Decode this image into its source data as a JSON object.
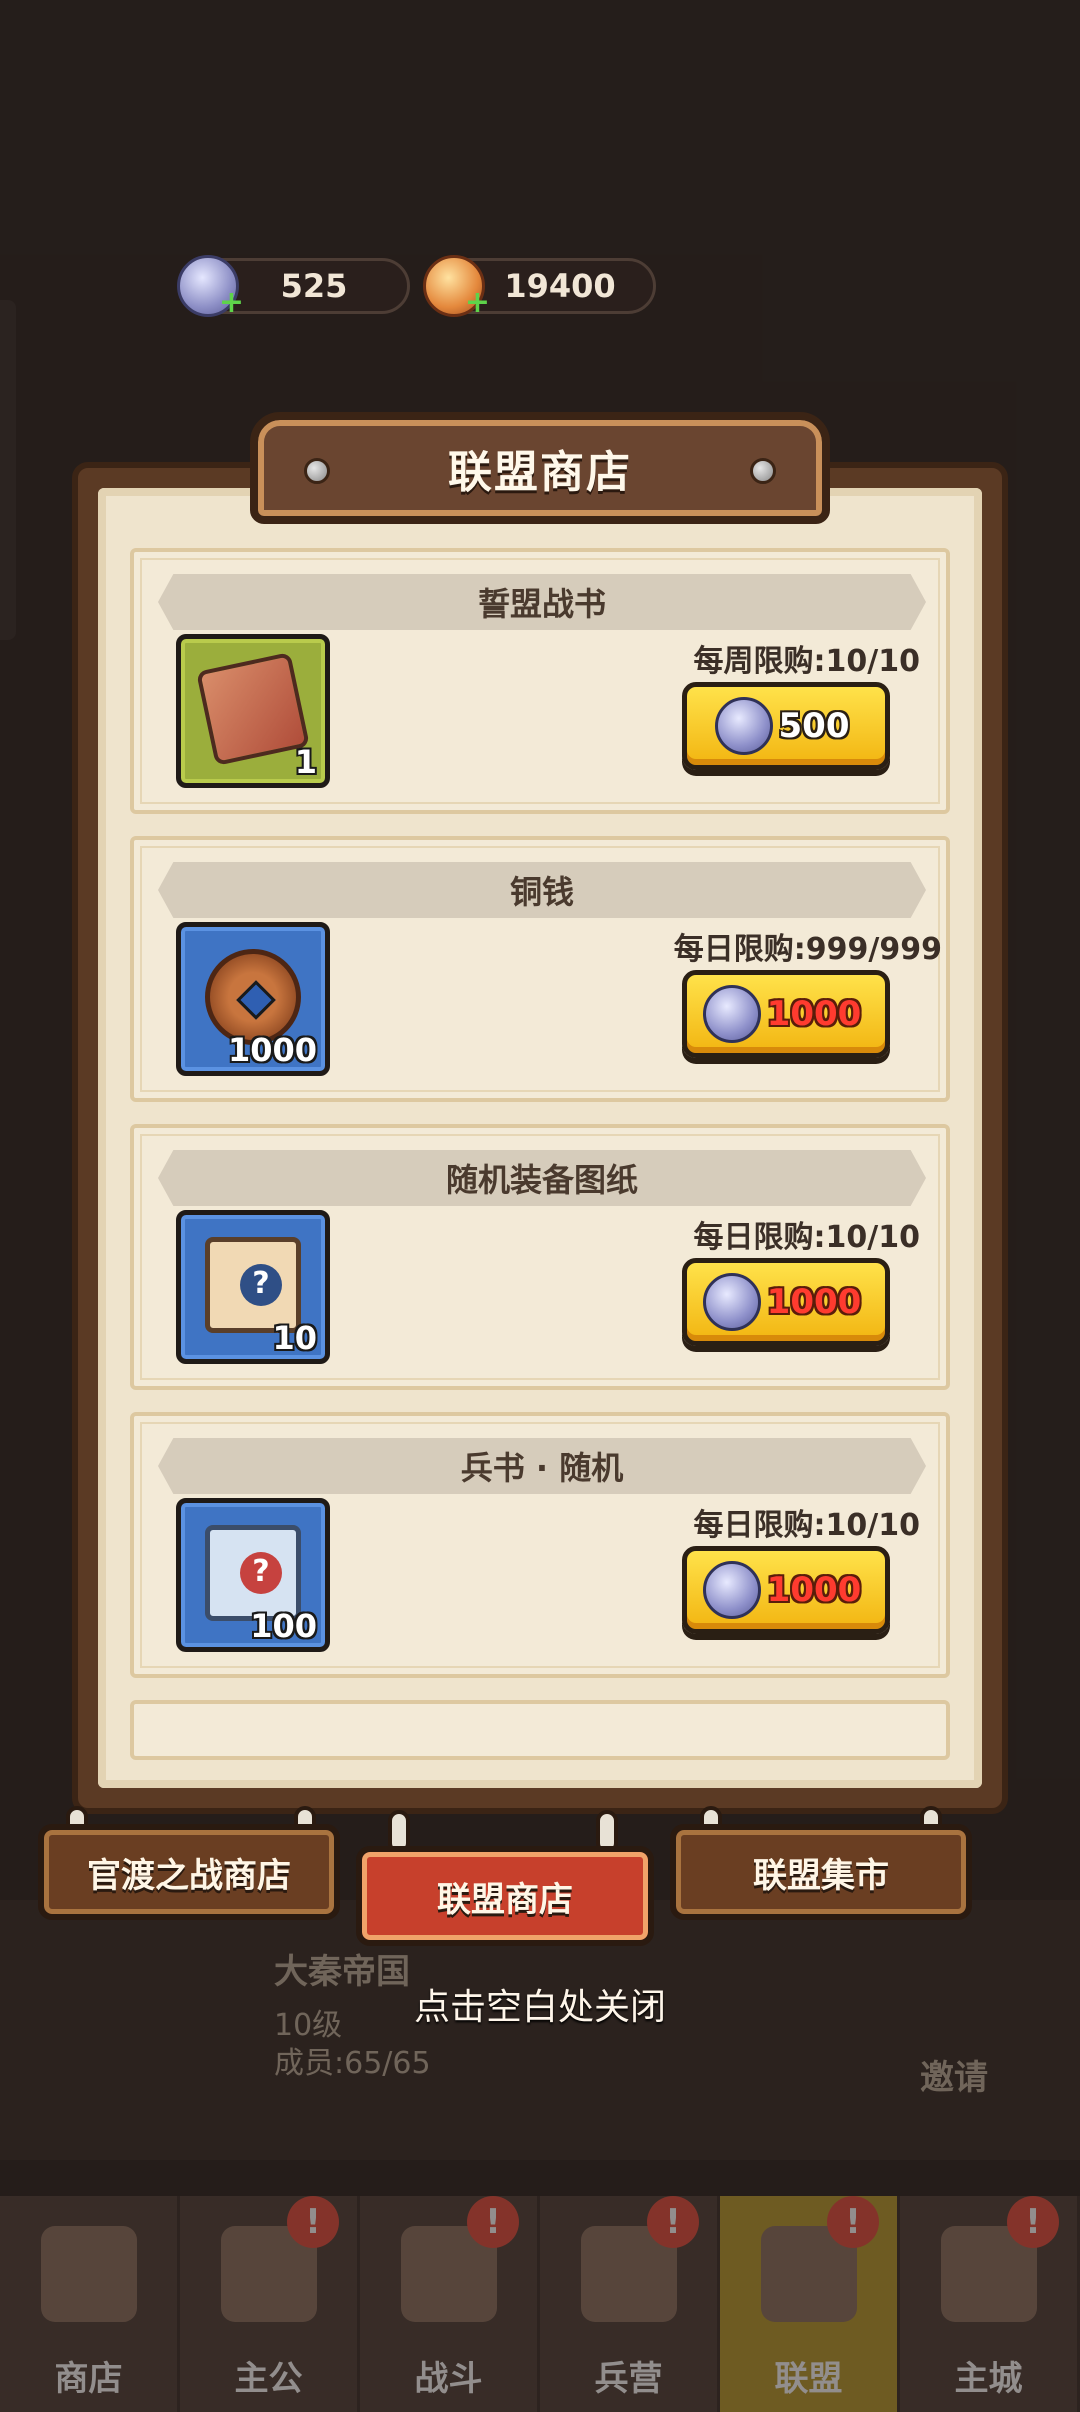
{
  "currencies": [
    {
      "name": "alliance-token",
      "value": "525",
      "color": "#8d8fc6"
    },
    {
      "name": "gold-token",
      "value": "19400",
      "color": "#e4883c"
    }
  ],
  "panel": {
    "title": "联盟商店"
  },
  "items": [
    {
      "name": "誓盟战书",
      "qty": "1",
      "limit": "每周限购:10/10",
      "price": "500",
      "price_style": "white",
      "slot_color": "green",
      "icon": "book-seal-icon"
    },
    {
      "name": "铜钱",
      "qty": "1000",
      "limit": "每日限购:999/999",
      "price": "1000",
      "price_style": "red",
      "slot_color": "blue",
      "icon": "coin-icon"
    },
    {
      "name": "随机装备图纸",
      "qty": "10",
      "limit": "每日限购:10/10",
      "price": "1000",
      "price_style": "red",
      "slot_color": "blue",
      "icon": "scroll-question-icon"
    },
    {
      "name": "兵书 · 随机",
      "qty": "100",
      "limit": "每日限购:10/10",
      "price": "1000",
      "price_style": "red",
      "slot_color": "blue",
      "icon": "war-book-scroll-icon"
    }
  ],
  "tabs": [
    {
      "label": "官渡之战商店",
      "active": false
    },
    {
      "label": "联盟商店",
      "active": true
    },
    {
      "label": "联盟集市",
      "active": false
    }
  ],
  "close_hint": "点击空白处关闭",
  "background": {
    "guild_name": "大秦帝国",
    "guild_level": "10级",
    "guild_members": "成员:65/65",
    "invite": "邀请"
  },
  "bottom_nav": [
    {
      "label": "商店",
      "badge": false
    },
    {
      "label": "主公",
      "badge": true
    },
    {
      "label": "战斗",
      "badge": true
    },
    {
      "label": "兵营",
      "badge": true
    },
    {
      "label": "联盟",
      "badge": true,
      "active": true
    },
    {
      "label": "主城",
      "badge": true
    }
  ],
  "badge_text": "!"
}
